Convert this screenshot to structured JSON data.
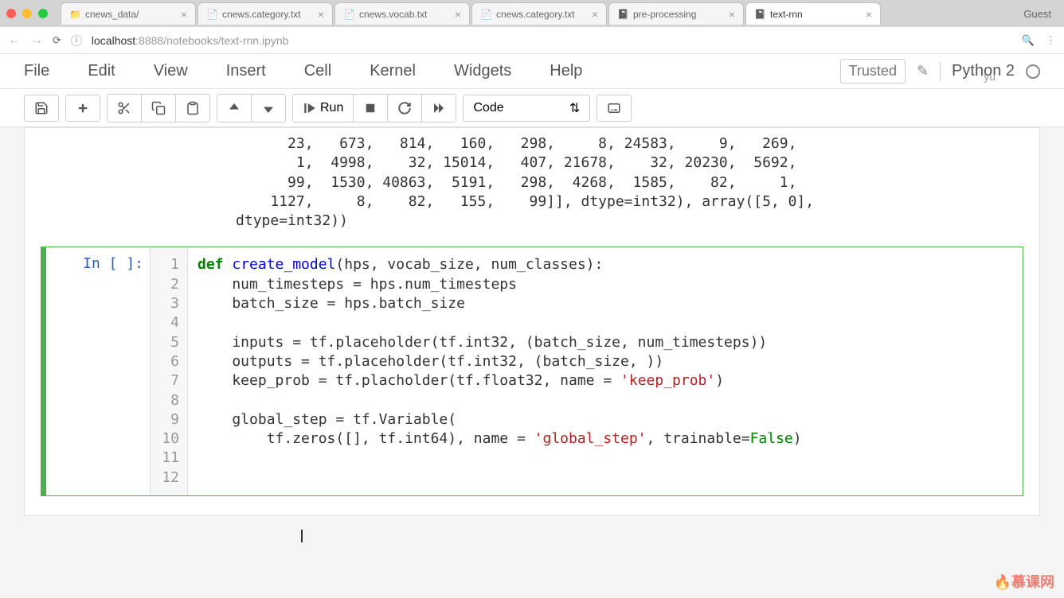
{
  "browser": {
    "tabs": [
      {
        "title": "cnews_data/",
        "favicon": "folder"
      },
      {
        "title": "cnews.category.txt",
        "favicon": "doc"
      },
      {
        "title": "cnews.vocab.txt",
        "favicon": "doc"
      },
      {
        "title": "cnews.category.txt",
        "favicon": "doc"
      },
      {
        "title": "pre-processing",
        "favicon": "nb"
      },
      {
        "title": "text-rnn",
        "favicon": "nb",
        "active": true
      }
    ],
    "guest": "Guest",
    "url_host": "localhost",
    "url_port": ":8888",
    "url_path": "/notebooks/text-rnn.ipynb"
  },
  "menu": {
    "items": [
      "File",
      "Edit",
      "View",
      "Insert",
      "Cell",
      "Kernel",
      "Widgets",
      "Help"
    ],
    "trusted": "Trusted",
    "kernel": "Python 2"
  },
  "toolbar": {
    "run_label": "Run",
    "celltype": "Code"
  },
  "output": "            23,   673,   814,   160,   298,     8, 24583,     9,   269,\n             1,  4998,    32, 15014,   407, 21678,    32, 20230,  5692,\n            99,  1530, 40863,  5191,   298,  4268,  1585,    82,     1,\n          1127,     8,    82,   155,    99]], dtype=int32), array([5, 0],\n      dtype=int32))",
  "cell": {
    "prompt": "In [ ]:",
    "line_numbers": [
      "1",
      "2",
      "3",
      "4",
      "5",
      "6",
      "7",
      "8",
      "9",
      "10",
      "11",
      "12"
    ],
    "code": {
      "l1_def": "def ",
      "l1_fn": "create_model",
      "l1_rest": "(hps, vocab_size, num_classes):",
      "l2": "    num_timesteps = hps.num_timesteps",
      "l3": "    batch_size = hps.batch_size",
      "l4": "",
      "l5": "    inputs = tf.placeholder(tf.int32, (batch_size, num_timesteps))",
      "l6": "    outputs = tf.placeholder(tf.int32, (batch_size, ))",
      "l7a": "    keep_prob = tf.placholder(tf.float32, name = ",
      "l7s": "'keep_prob'",
      "l7b": ")",
      "l8": "",
      "l9": "    global_step = tf.Variable(",
      "l10a": "        tf.zeros([], tf.int64), name = ",
      "l10s": "'global_step'",
      "l10b": ", trainable=",
      "l10bool": "False",
      "l10c": ")",
      "l11": "",
      "l12": "    "
    }
  },
  "watermark": "慕课网",
  "watermark_yu": "yu"
}
